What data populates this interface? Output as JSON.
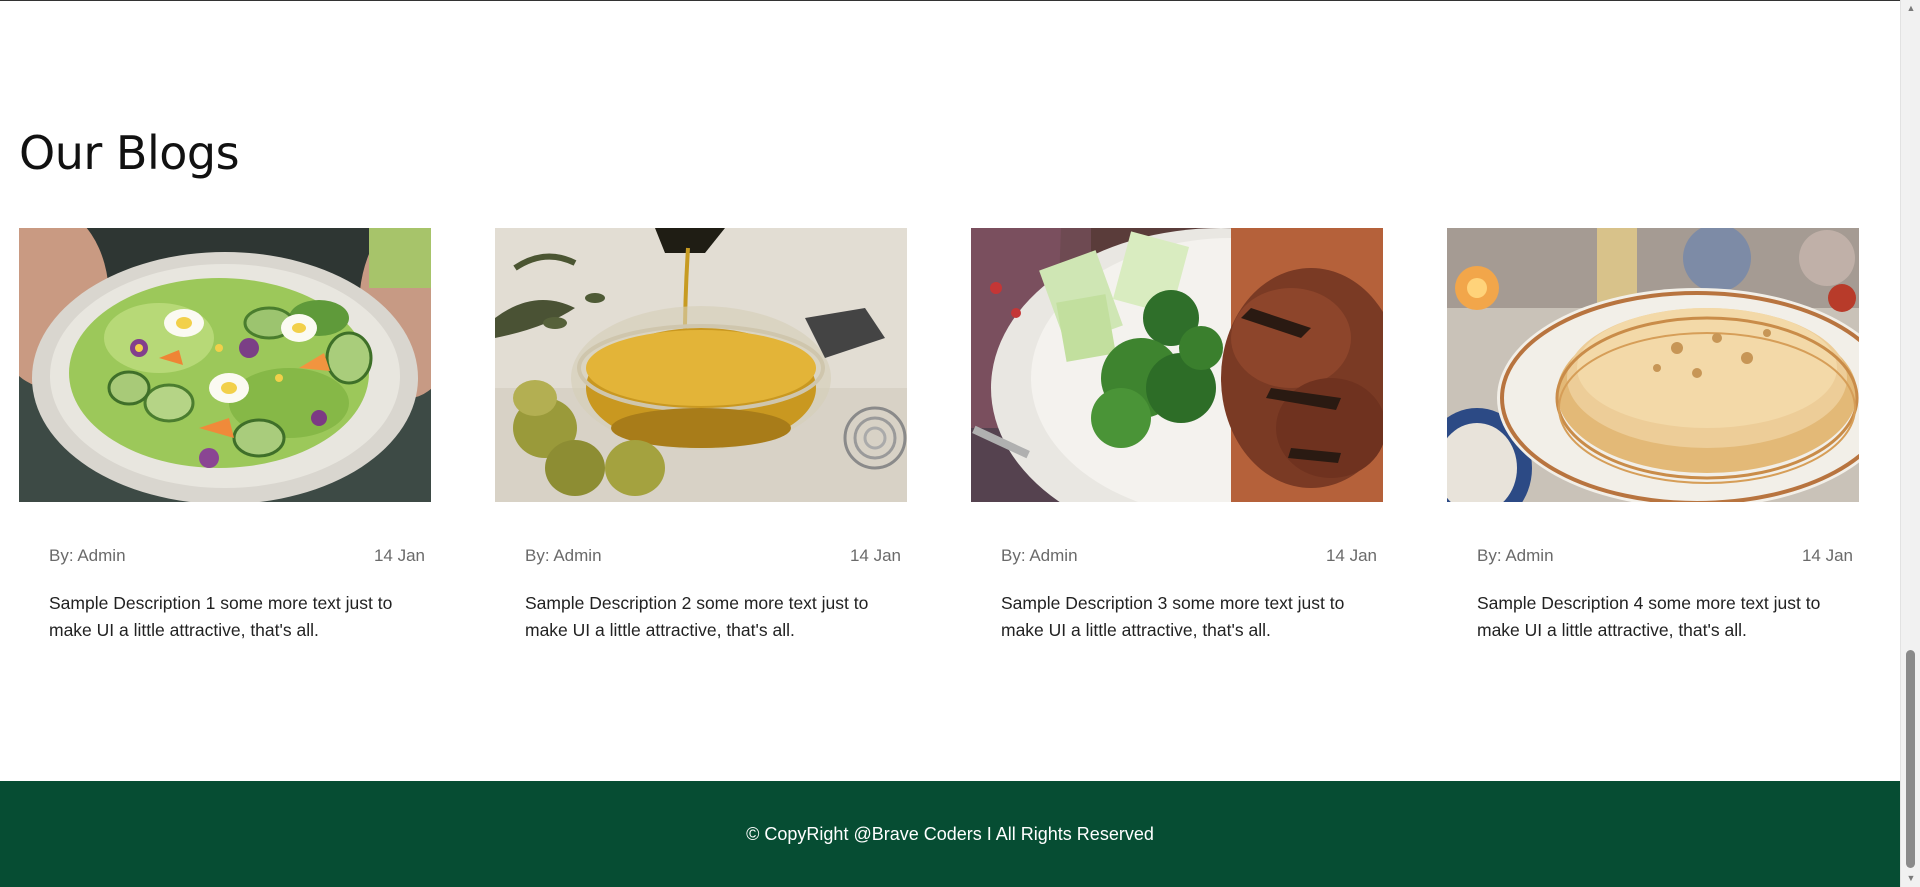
{
  "section": {
    "title": "Our Blogs"
  },
  "blogs": [
    {
      "author": "By: Admin",
      "date": "14 Jan",
      "description": "Sample Description 1 some more text just to make UI a little attractive, that's all.",
      "image": "salad-bowl-photo"
    },
    {
      "author": "By: Admin",
      "date": "14 Jan",
      "description": "Sample Description 2 some more text just to make UI a little attractive, that's all.",
      "image": "olive-oil-photo"
    },
    {
      "author": "By: Admin",
      "date": "14 Jan",
      "description": "Sample Description 3 some more text just to make UI a little attractive, that's all.",
      "image": "grilled-meat-plate-photo"
    },
    {
      "author": "By: Admin",
      "date": "14 Jan",
      "description": "Sample Description 4 some more text just to make UI a little attractive, that's all.",
      "image": "pancakes-plate-photo"
    }
  ],
  "footer": {
    "text": "© CopyRight @Brave Coders I All Rights Reserved"
  },
  "colors": {
    "footer_bg": "#064d33",
    "footer_text": "#ffffff",
    "meta_text": "#6a6a6a"
  },
  "scrollbar": {
    "position_percent": 96
  }
}
